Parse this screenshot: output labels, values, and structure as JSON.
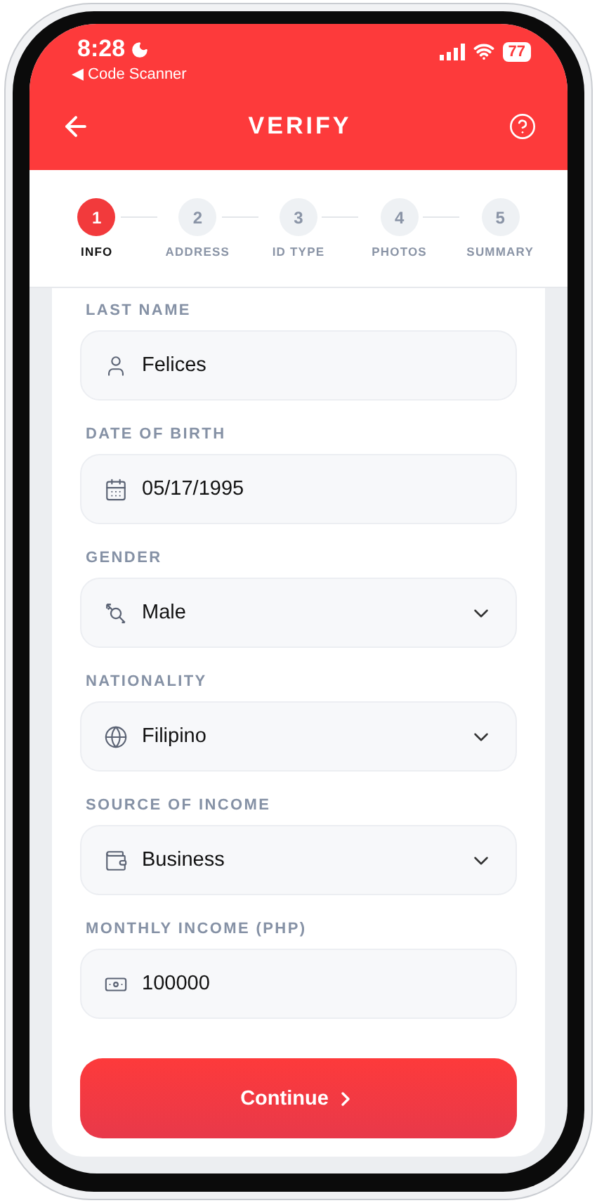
{
  "status_bar": {
    "time": "8:28",
    "back_app": "◀ Code Scanner",
    "battery": "77"
  },
  "header": {
    "title": "VERIFY"
  },
  "steps": [
    {
      "number": "1",
      "label": "INFO",
      "selected": true
    },
    {
      "number": "2",
      "label": "ADDRESS",
      "selected": false
    },
    {
      "number": "3",
      "label": "ID TYPE",
      "selected": false
    },
    {
      "number": "4",
      "label": "PHOTOS",
      "selected": false
    },
    {
      "number": "5",
      "label": "SUMMARY",
      "selected": false
    }
  ],
  "fields": [
    {
      "label": "LAST NAME",
      "value": "Felices",
      "kind": "input"
    },
    {
      "label": "DATE OF BIRTH",
      "value": "05/17/1995",
      "kind": "input"
    },
    {
      "label": "GENDER",
      "value": "Male",
      "kind": "select"
    },
    {
      "label": "NATIONALITY",
      "value": "Filipino",
      "kind": "select"
    },
    {
      "label": "SOURCE OF INCOME",
      "value": "Business",
      "kind": "select"
    },
    {
      "label": "MONTHLY INCOME (PHP)",
      "value": "100000",
      "kind": "input"
    }
  ],
  "button": {
    "label": "Continue"
  }
}
